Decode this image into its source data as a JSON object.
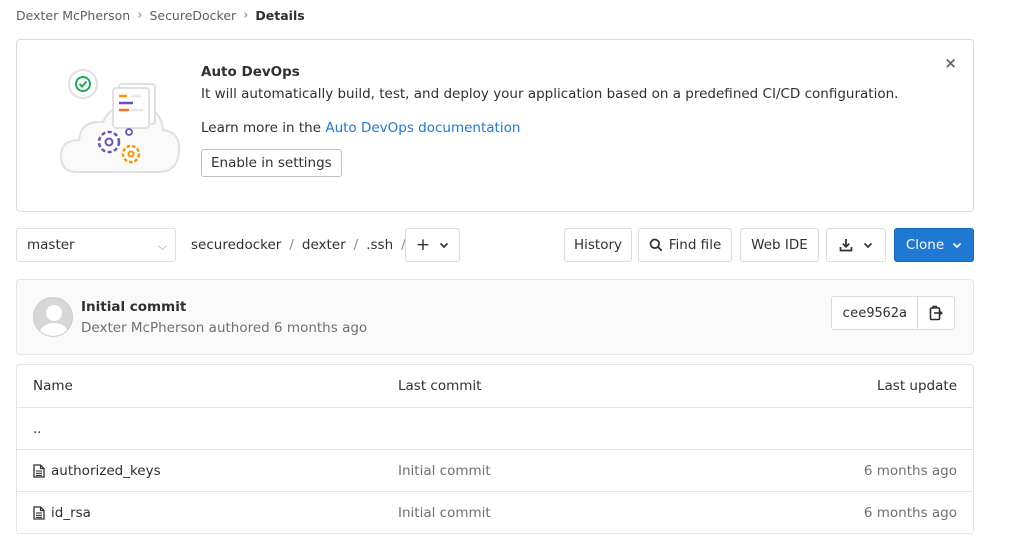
{
  "breadcrumb": {
    "items": [
      "Dexter McPherson",
      "SecureDocker"
    ],
    "current": "Details"
  },
  "devops_banner": {
    "title": "Auto DevOps",
    "description": "It will automatically build, test, and deploy your application based on a predefined CI/CD configuration.",
    "learn_prefix": "Learn more in the ",
    "learn_link": "Auto DevOps documentation",
    "button": "Enable in settings",
    "close": "×"
  },
  "toolbar": {
    "branch": "master",
    "path": [
      "securedocker",
      "dexter",
      ".ssh"
    ],
    "path_sep": "/",
    "add": "+",
    "history": "History",
    "find_file": "Find file",
    "web_ide": "Web IDE",
    "clone": "Clone"
  },
  "last_commit": {
    "title": "Initial commit",
    "author": "Dexter McPherson",
    "action": "authored",
    "time": "6 months ago",
    "sha": "cee9562a"
  },
  "files": {
    "headers": [
      "Name",
      "Last commit",
      "Last update"
    ],
    "parent": "..",
    "rows": [
      {
        "name": "authorized_keys",
        "commit": "Initial commit",
        "updated": "6 months ago"
      },
      {
        "name": "id_rsa",
        "commit": "Initial commit",
        "updated": "6 months ago"
      }
    ]
  },
  "colors": {
    "primary": "#1f78d1",
    "link": "#1f78d1",
    "border": "#dbdbdb"
  }
}
